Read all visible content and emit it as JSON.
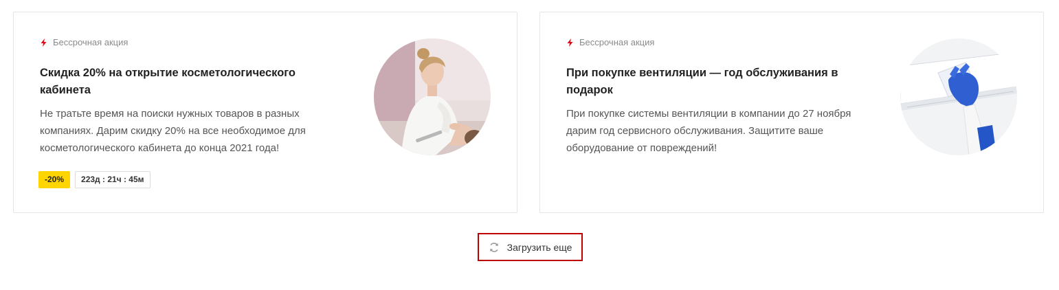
{
  "cards": [
    {
      "tag": "Бессрочная акция",
      "title": "Скидка 20% на открытие косметологического кабинета",
      "description": "Не тратьте время на поиски нужных товаров в разных компаниях. Дарим скидку 20% на все необходимое для косметологического кабинета до конца 2021 года!",
      "discount": "-20%",
      "timer": "223д : 21ч : 45м"
    },
    {
      "tag": "Бессрочная акция",
      "title": "При покупке вентиляции — год обслуживания в подарок",
      "description": "При покупке системы вентиляции в компании до 27 ноября дарим год сервисного обслуживания. Защитите ваше оборудование от повреждений!"
    }
  ],
  "load_more": {
    "label": "Загрузить еще",
    "icon": "refresh-icon"
  },
  "colors": {
    "accent_red": "#e30613",
    "discount_yellow": "#ffd500",
    "highlight_border": "#c00000"
  }
}
